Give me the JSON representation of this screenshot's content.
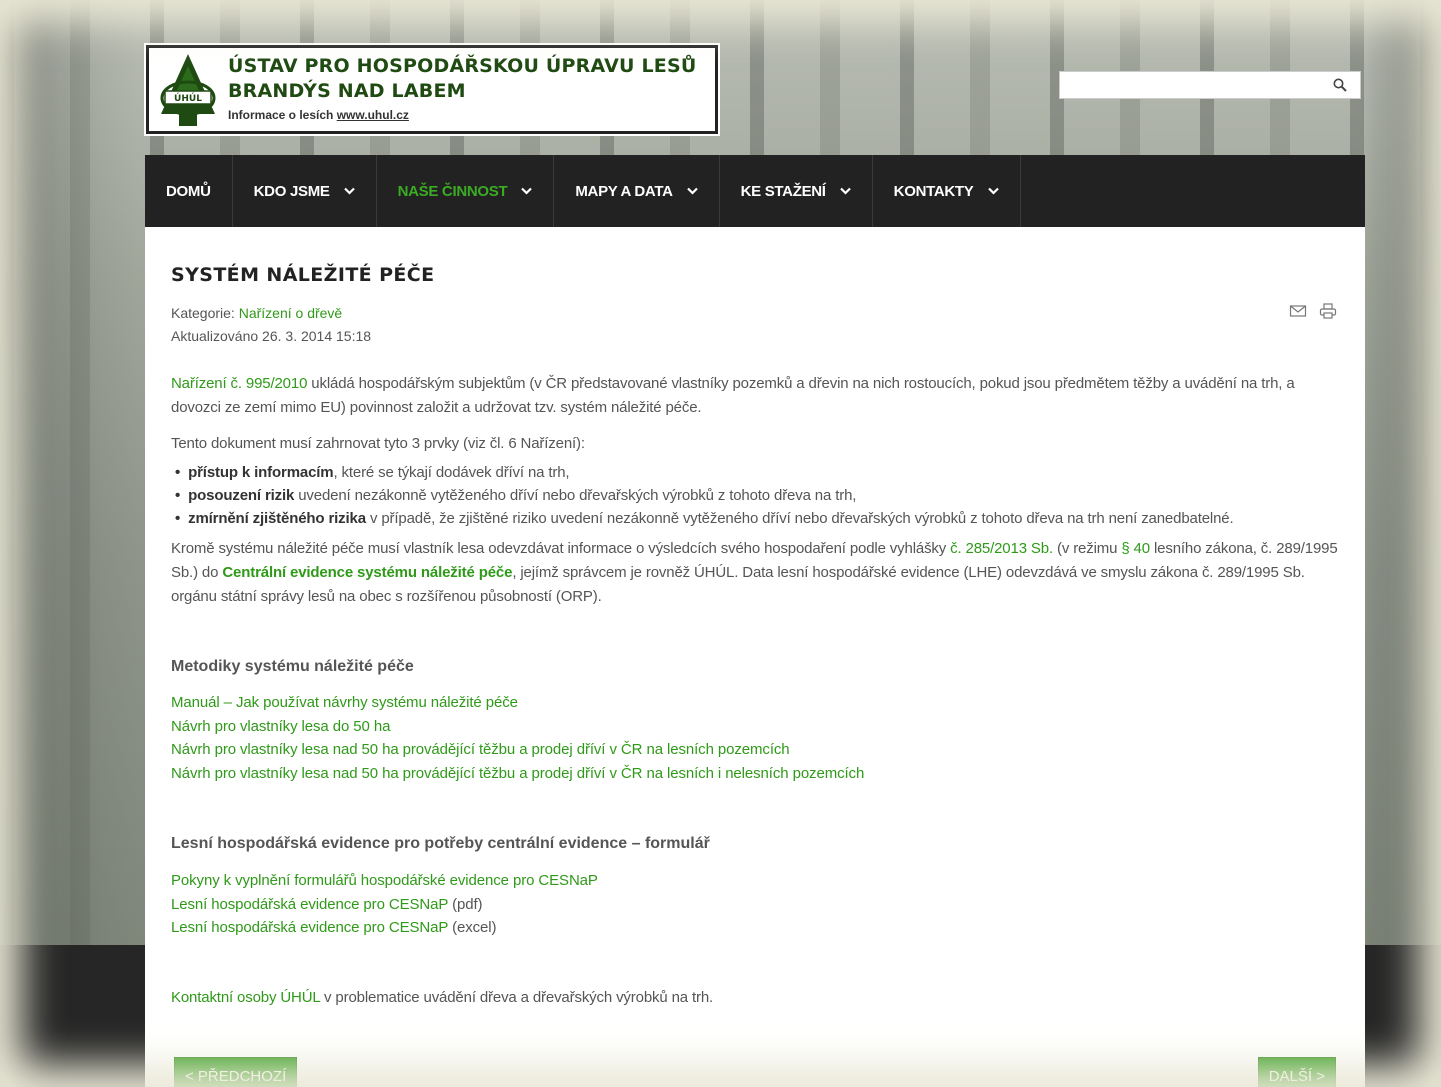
{
  "header": {
    "title_line1": "ÚSTAV PRO HOSPODÁŘSKOU ÚPRAVU LESŮ",
    "title_line2": "BRANDÝS NAD LABEM",
    "subtitle_prefix": "Informace o lesích ",
    "subtitle_link": "www.uhul.cz",
    "emblem_text": "ÚHÚL"
  },
  "search": {
    "placeholder": "",
    "icon": "search-icon"
  },
  "nav": {
    "items": [
      {
        "label": "DOMŮ",
        "dropdown": false
      },
      {
        "label": "KDO JSME",
        "dropdown": true
      },
      {
        "label": "NAŠE ČINNOST",
        "dropdown": true,
        "active": true
      },
      {
        "label": "MAPY A DATA",
        "dropdown": true
      },
      {
        "label": "KE STAŽENÍ",
        "dropdown": true
      },
      {
        "label": "KONTAKTY",
        "dropdown": true
      }
    ]
  },
  "article": {
    "title": "SYSTÉM NÁLEŽITÉ PÉČE",
    "category_label": "Kategorie: ",
    "category_link": "Nařízení o dřevě",
    "updated": "Aktualizováno 26. 3. 2014 15:18",
    "p1_link": "Nařízení č. 995/2010",
    "p1_text": " ukládá hospodářským subjektům (v ČR představované vlastníky pozemků a dřevin na nich rostoucích, pokud jsou předmětem těžby a uvádění na trh, a dovozci ze zemí mimo EU) povinnost založit a udržovat tzv. systém náležité péče.",
    "p2": "Tento dokument musí zahrnovat tyto 3 prvky (viz čl. 6 Nařízení):",
    "bullets": [
      {
        "bold": "přístup k informacím",
        "text": ", které se týkají dodávek dříví na trh,"
      },
      {
        "bold": "posouzení rizik",
        "text": " uvedení nezákonně vytěženého dříví nebo dřevařských výrobků z tohoto dřeva na trh,"
      },
      {
        "bold": "zmírnění zjištěného rizika",
        "text": " v případě, že zjištěné riziko uvedení nezákonně vytěženého dříví nebo dřevařských výrobků z tohoto dřeva na trh není zanedbatelné."
      }
    ],
    "p3_a": "Kromě systému náležité péče musí vlastník lesa odevzdávat informace o výsledcích svého hospodaření podle vyhlášky ",
    "p3_link1": "č. 285/2013 Sb.",
    "p3_b": " (v režimu ",
    "p3_link2": "§ 40",
    "p3_c": " lesního zákona, č. 289/1995 Sb.) do ",
    "p3_link3": "Centrální evidence systému náležité péče",
    "p3_d": ", jejímž správcem je rovněž ÚHÚL. Data lesní hospodářské evidence (LHE) odevzdává ve smyslu zákona č. 289/1995 Sb. orgánu státní správy lesů na obec s rozšířenou působností (ORP).",
    "h_methods": "Metodiky systému náležité péče",
    "methods": [
      "Manuál – Jak používat návrhy systému náležité péče",
      "Návrh pro vlastníky lesa do 50 ha",
      "Návrh pro vlastníky lesa nad 50 ha provádějící těžbu a prodej dříví v ČR na lesních pozemcích",
      "Návrh pro vlastníky lesa nad 50 ha provádějící těžbu a prodej dříví v ČR na lesních i nelesních pozemcích"
    ],
    "h_lhe": "Lesní hospodářská evidence pro potřeby centrální evidence – formulář",
    "lhe_links": [
      {
        "link": "Pokyny k vyplnění formulářů hospodářské evidence pro CESNaP",
        "suffix": ""
      },
      {
        "link": "Lesní hospodářská evidence pro CESNaP",
        "suffix": " (pdf)"
      },
      {
        "link": "Lesní hospodářská evidence pro CESNaP",
        "suffix": " (excel)"
      }
    ],
    "contact_link": "Kontaktní osoby ÚHÚL",
    "contact_text": " v problematice uvádění dřeva a dřevařských výrobků na trh.",
    "prev_label": "< PŘEDCHOZÍ",
    "next_label": "DALŠÍ >"
  },
  "colors": {
    "accent": "#2f9a19",
    "nav_bg": "#222222",
    "logo_green": "#1f4a12"
  }
}
